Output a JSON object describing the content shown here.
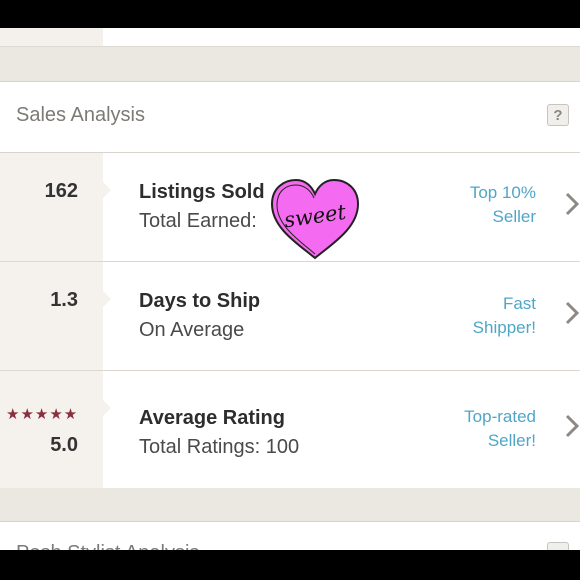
{
  "section": {
    "title": "Sales Analysis",
    "help_label": "?"
  },
  "rows": [
    {
      "metric": "162",
      "title": "Listings Sold",
      "subtitle": "Total Earned:",
      "badge_line1": "Top 10%",
      "badge_line2": "Seller"
    },
    {
      "metric": "1.3",
      "title": "Days to Ship",
      "subtitle": "On Average",
      "badge_line1": "Fast",
      "badge_line2": "Shipper!"
    },
    {
      "stars": "★★★★★",
      "metric": "5.0",
      "title": "Average Rating",
      "subtitle": "Total Ratings: 100",
      "badge_line1": "Top-rated",
      "badge_line2": "Seller!"
    }
  ],
  "sticker": {
    "text": "sweet",
    "color": "#f46af0",
    "icon": "heart-sticker"
  },
  "next_section": {
    "title": "Posh Stylist Analysis"
  },
  "colors": {
    "accent": "#4fa6c7",
    "star": "#8b2f3f"
  }
}
